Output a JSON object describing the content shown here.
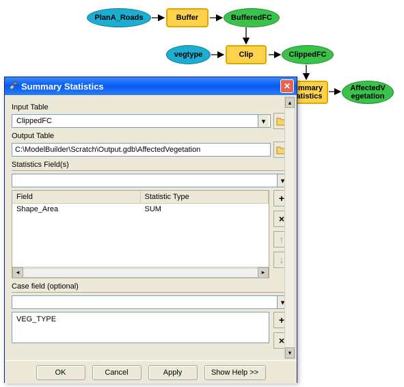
{
  "diagram": {
    "nodes": {
      "plana": "PlanA_Roads",
      "buffer": "Buffer",
      "bufferedfc": "BufferedFC",
      "vegtype": "vegtype",
      "clip": "Clip",
      "clippedfc": "ClippedFC",
      "summary": "Summary\nStatistics",
      "affected": "AffectedV\negetation"
    }
  },
  "dialog": {
    "title": "Summary Statistics",
    "labels": {
      "input_table": "Input Table",
      "output_table": "Output Table",
      "stat_fields": "Statistics Field(s)",
      "case_field": "Case field (optional)"
    },
    "values": {
      "input_table": "ClippedFC",
      "output_table": "C:\\ModelBuilder\\Scratch\\Output.gdb\\AffectedVegetation"
    },
    "stat_grid": {
      "headers": {
        "field": "Field",
        "type": "Statistic Type"
      },
      "rows": [
        {
          "field": "Shape_Area",
          "type": "SUM"
        }
      ]
    },
    "case_list": [
      "VEG_TYPE"
    ],
    "buttons": {
      "ok": "OK",
      "cancel": "Cancel",
      "apply": "Apply",
      "help": "Show Help >>"
    }
  }
}
